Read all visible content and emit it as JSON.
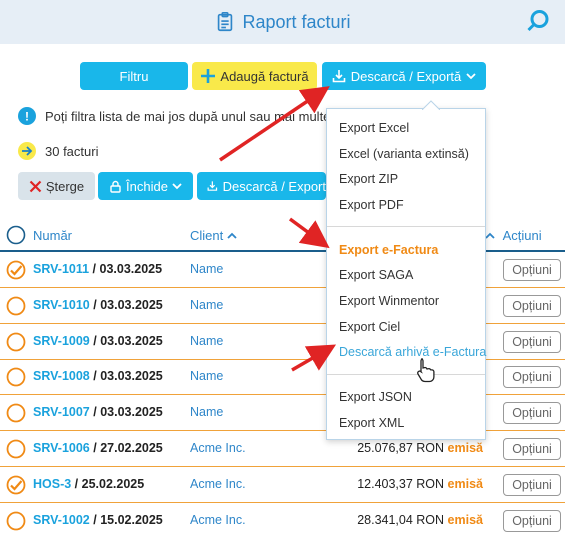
{
  "header": {
    "title": "Raport facturi"
  },
  "toolbar": {
    "filter_label": "Filtru",
    "add_invoice_label": "Adaugă factură",
    "export_label": "Descarcă / Exportă"
  },
  "info": {
    "filter_hint": "Poți filtra lista de mai jos după unul sau mai multe",
    "count_text": "30 facturi"
  },
  "actions": {
    "delete_label": "Șterge",
    "close_label": "Închide",
    "export_label": "Descarcă / Export"
  },
  "table": {
    "columns": {
      "number": "Număr",
      "client": "Client",
      "actions": "Acțiuni"
    },
    "options_label": "Opțiuni",
    "rows": [
      {
        "id": "SRV-1011",
        "date": "03.03.2025",
        "client": "Name",
        "amount": "",
        "status": "",
        "checked": true
      },
      {
        "id": "SRV-1010",
        "date": "03.03.2025",
        "client": "Name",
        "amount": "",
        "status": "",
        "checked": false
      },
      {
        "id": "SRV-1009",
        "date": "03.03.2025",
        "client": "Name",
        "amount": "",
        "status": "",
        "checked": false
      },
      {
        "id": "SRV-1008",
        "date": "03.03.2025",
        "client": "Name",
        "amount": "",
        "status": "",
        "checked": false
      },
      {
        "id": "SRV-1007",
        "date": "03.03.2025",
        "client": "Name",
        "amount": "",
        "status": "",
        "checked": false
      },
      {
        "id": "SRV-1006",
        "date": "27.02.2025",
        "client": "Acme Inc.",
        "amount": "25.076,87 RON",
        "status": "emisă",
        "checked": false
      },
      {
        "id": "HOS-3",
        "date": "25.02.2025",
        "client": "Acme Inc.",
        "amount": "12.403,37 RON",
        "status": "emisă",
        "checked": true
      },
      {
        "id": "SRV-1002",
        "date": "15.02.2025",
        "client": "Acme Inc.",
        "amount": "28.341,04 RON",
        "status": "emisă",
        "checked": false
      }
    ]
  },
  "dropdown": {
    "items": [
      {
        "label": "Export Excel",
        "style": "normal"
      },
      {
        "label": "Excel (varianta extinsă)",
        "style": "normal"
      },
      {
        "label": "Export ZIP",
        "style": "normal"
      },
      {
        "label": "Export PDF",
        "style": "normal"
      },
      {
        "label": "Export e-Factura",
        "style": "highlight"
      },
      {
        "label": "Export SAGA",
        "style": "normal"
      },
      {
        "label": "Export Winmentor",
        "style": "normal"
      },
      {
        "label": "Export Ciel",
        "style": "normal"
      },
      {
        "label": "Descarcă arhivă e-Factura",
        "style": "link"
      },
      {
        "label": "Export JSON",
        "style": "normal"
      },
      {
        "label": "Export XML",
        "style": "normal"
      }
    ]
  },
  "colors": {
    "accent": "#19b7ea",
    "add_button": "#f9e94a",
    "row_border": "#f0a23a",
    "status": "#f08a15",
    "highlight_item": "#f08a15",
    "link_item": "#3aa6d9",
    "annotation_arrow": "#e02424"
  }
}
